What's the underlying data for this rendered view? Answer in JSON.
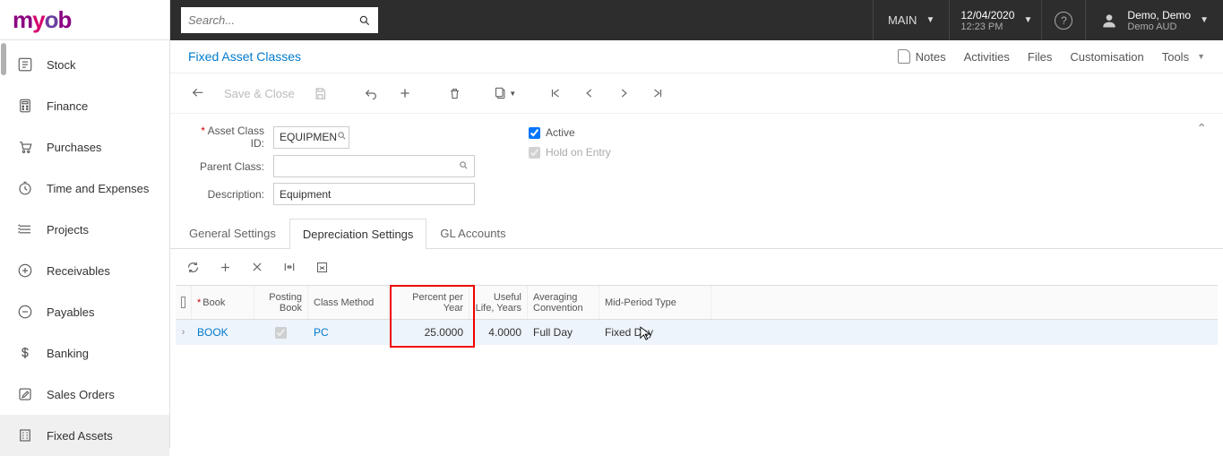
{
  "logo": {
    "m": "m",
    "y": "y",
    "o": "o",
    "b": "b"
  },
  "search": {
    "placeholder": "Search..."
  },
  "topbar": {
    "main_label": "MAIN",
    "date": "12/04/2020",
    "time": "12:23 PM",
    "user_name": "Demo, Demo",
    "user_sub": "Demo AUD"
  },
  "sidebar": {
    "items": [
      {
        "label": "Stock"
      },
      {
        "label": "Finance"
      },
      {
        "label": "Purchases"
      },
      {
        "label": "Time and Expenses"
      },
      {
        "label": "Projects"
      },
      {
        "label": "Receivables"
      },
      {
        "label": "Payables"
      },
      {
        "label": "Banking"
      },
      {
        "label": "Sales Orders"
      },
      {
        "label": "Fixed Assets"
      }
    ]
  },
  "breadcrumb": "Fixed Asset Classes",
  "header_actions": {
    "notes": "Notes",
    "activities": "Activities",
    "files": "Files",
    "customisation": "Customisation",
    "tools": "Tools"
  },
  "toolbar": {
    "save_close": "Save & Close"
  },
  "form": {
    "asset_class_label": "Asset Class ID:",
    "asset_class_value": "EQUIPMEN",
    "parent_class_label": "Parent Class:",
    "parent_class_value": "",
    "description_label": "Description:",
    "description_value": "Equipment",
    "active_label": "Active",
    "hold_label": "Hold on Entry"
  },
  "tabs": [
    {
      "label": "General Settings"
    },
    {
      "label": "Depreciation Settings"
    },
    {
      "label": "GL Accounts"
    }
  ],
  "grid": {
    "headers": {
      "book": "Book",
      "posting_book": "Posting Book",
      "class_method": "Class Method",
      "percent_per_year": "Percent per Year",
      "useful_life": "Useful Life, Years",
      "averaging": "Averaging Convention",
      "mid_period": "Mid-Period Type"
    },
    "row": {
      "book": "BOOK",
      "class_method": "PC",
      "percent_per_year": "25.0000",
      "useful_life": "4.0000",
      "averaging": "Full Day",
      "mid_period": "Fixed Day"
    }
  }
}
